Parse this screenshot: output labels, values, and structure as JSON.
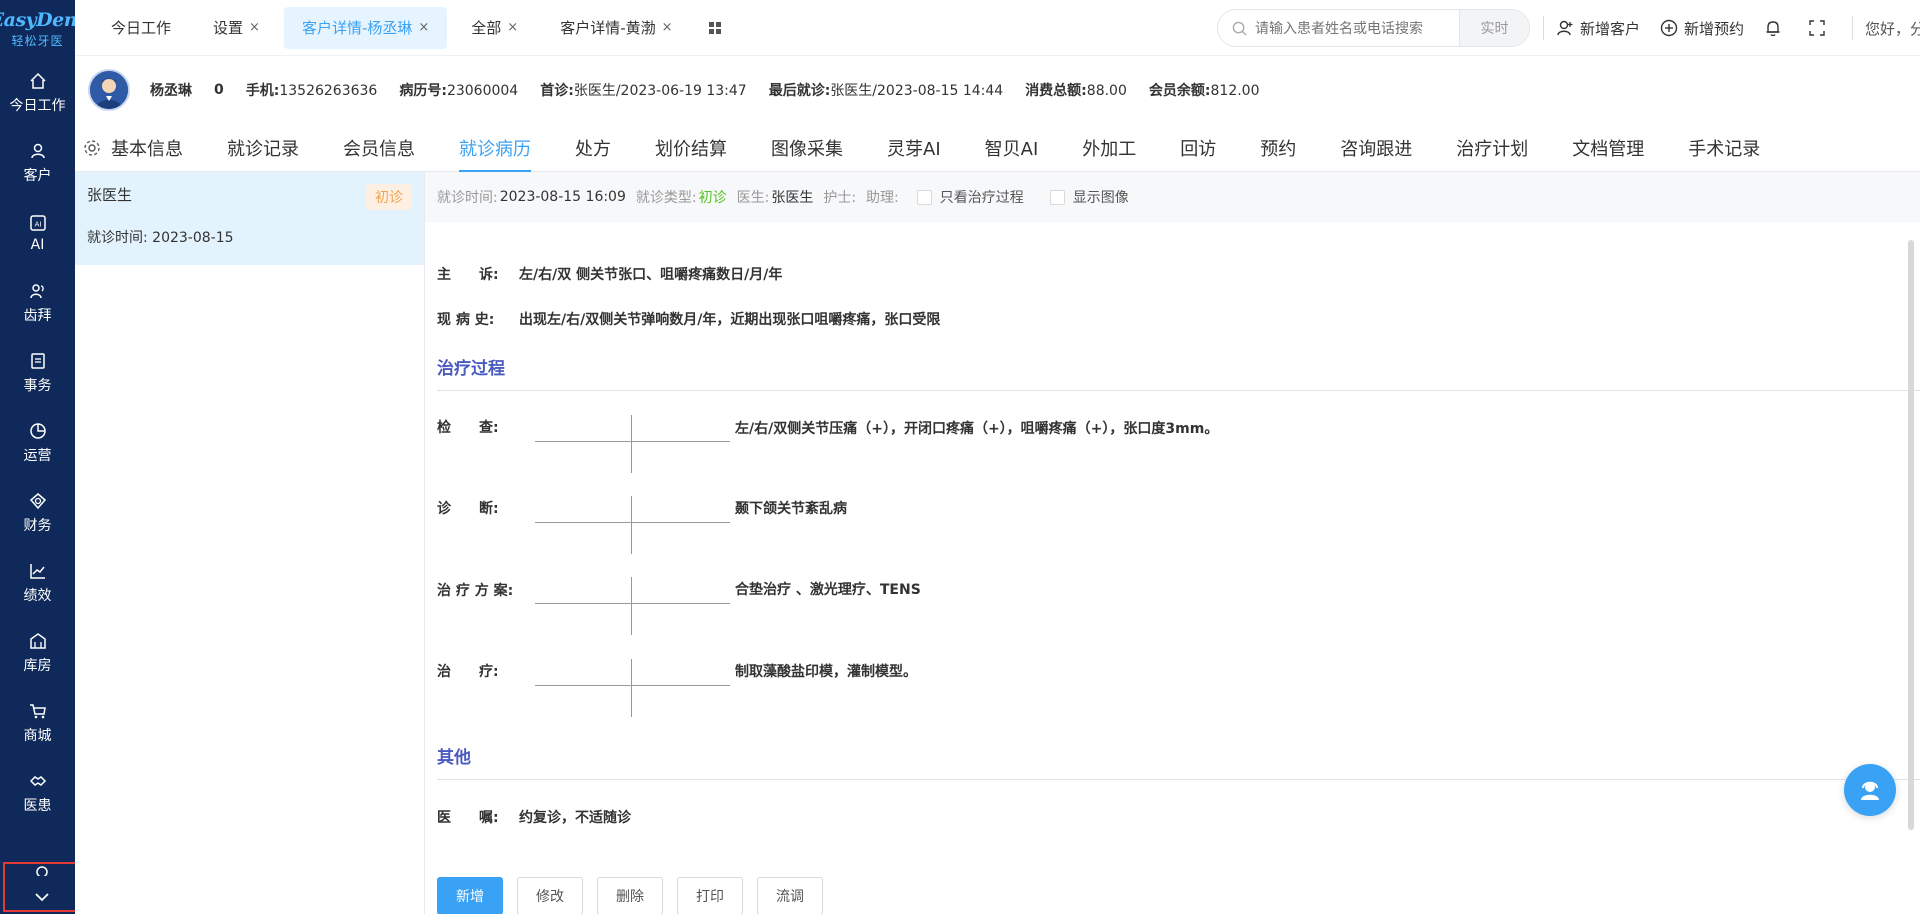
{
  "brand": {
    "logo_text": "EasyDent",
    "logo_sub": "轻松牙医"
  },
  "sidebar": {
    "items": [
      {
        "label": "今日工作",
        "icon": "home-icon"
      },
      {
        "label": "客户",
        "icon": "user-icon"
      },
      {
        "label": "AI",
        "icon": "ai-icon"
      },
      {
        "label": "齿拜",
        "icon": "users-icon"
      },
      {
        "label": "事务",
        "icon": "document-icon"
      },
      {
        "label": "运营",
        "icon": "pie-chart-icon"
      },
      {
        "label": "财务",
        "icon": "finance-icon"
      },
      {
        "label": "绩效",
        "icon": "line-chart-icon"
      },
      {
        "label": "库房",
        "icon": "warehouse-icon"
      },
      {
        "label": "商城",
        "icon": "cart-icon"
      },
      {
        "label": "医患",
        "icon": "handshake-icon"
      }
    ],
    "more_icon": "chevron-down-icon"
  },
  "tabs": [
    {
      "label": "今日工作",
      "closable": false
    },
    {
      "label": "设置",
      "closable": true
    },
    {
      "label": "客户详情-杨丞琳",
      "closable": true,
      "active": true
    },
    {
      "label": "全部",
      "closable": true
    },
    {
      "label": "客户详情-黄渤",
      "closable": true
    }
  ],
  "close_glyph": "×",
  "search": {
    "placeholder": "请输入患者姓名或电话搜索",
    "mode": "实时"
  },
  "top_actions": {
    "new_customer": "新增客户",
    "new_appointment": "新增预约",
    "greeting": "您好，分店超管"
  },
  "patient": {
    "name": "杨丞琳",
    "count": "0",
    "phone_label": "手机:",
    "phone": "13526263636",
    "record_label": "病历号:",
    "record": "23060004",
    "first_label": "首诊:",
    "first": "张医生/2023-06-19 13:47",
    "last_label": "最后就诊:",
    "last": "张医生/2023-08-15 14:44",
    "spent_label": "消费总额:",
    "spent": "88.00",
    "balance_label": "会员余额:",
    "balance": "812.00"
  },
  "subtabs": [
    "基本信息",
    "就诊记录",
    "会员信息",
    "就诊病历",
    "处方",
    "划价结算",
    "图像采集",
    "灵芽AI",
    "智贝AI",
    "外加工",
    "回访",
    "预约",
    "咨询跟进",
    "治疗计划",
    "文档管理",
    "手术记录"
  ],
  "active_subtab": 3,
  "record_list": [
    {
      "doctor": "张医生",
      "badge": "初诊",
      "time": "就诊时间: 2023-08-15"
    }
  ],
  "visit": {
    "time_label": "就诊时间:",
    "time": "2023-08-15 16:09",
    "type_label": "就诊类型:",
    "type": "初诊",
    "doctor_label": "医生:",
    "doctor": "张医生",
    "nurse_label": "护士:",
    "assistant_label": "助理:",
    "only_treatment": "只看治疗过程",
    "show_image": "显示图像"
  },
  "record": {
    "complaint_label": "主　　诉:",
    "complaint": "左/右/双 侧关节张口、咀嚼疼痛数日/月/年",
    "history_label": "现 病 史:",
    "history": "出现左/右/双侧关节弹响数月/年，近期出现张口咀嚼疼痛，张口受限",
    "section_treatment": "治疗过程",
    "exam_label": "检　　查:",
    "exam": "左/右/双侧关节压痛（+），开闭口疼痛（+），咀嚼疼痛（+），张口度3mm。",
    "diagnosis_label": "诊　　断:",
    "diagnosis": "颞下颌关节紊乱病",
    "plan_label": "治 疗 方 案:",
    "plan": "合垫治疗 、激光理疗、TENS",
    "treat_label": "治　　疗:",
    "treat": "制取藻酸盐印模，灌制模型。",
    "section_other": "其他",
    "advice_label": "医　　嘱:",
    "advice": "约复诊，不适随诊"
  },
  "actions": {
    "add": "新增",
    "edit": "修改",
    "delete": "删除",
    "print": "打印",
    "transfer": "流调"
  },
  "colors": {
    "sidebar": "#0f2a5a",
    "accent": "#3aa2f5",
    "section": "#4a5bc0",
    "badge": "#f0a44a",
    "green": "#52c41a"
  }
}
